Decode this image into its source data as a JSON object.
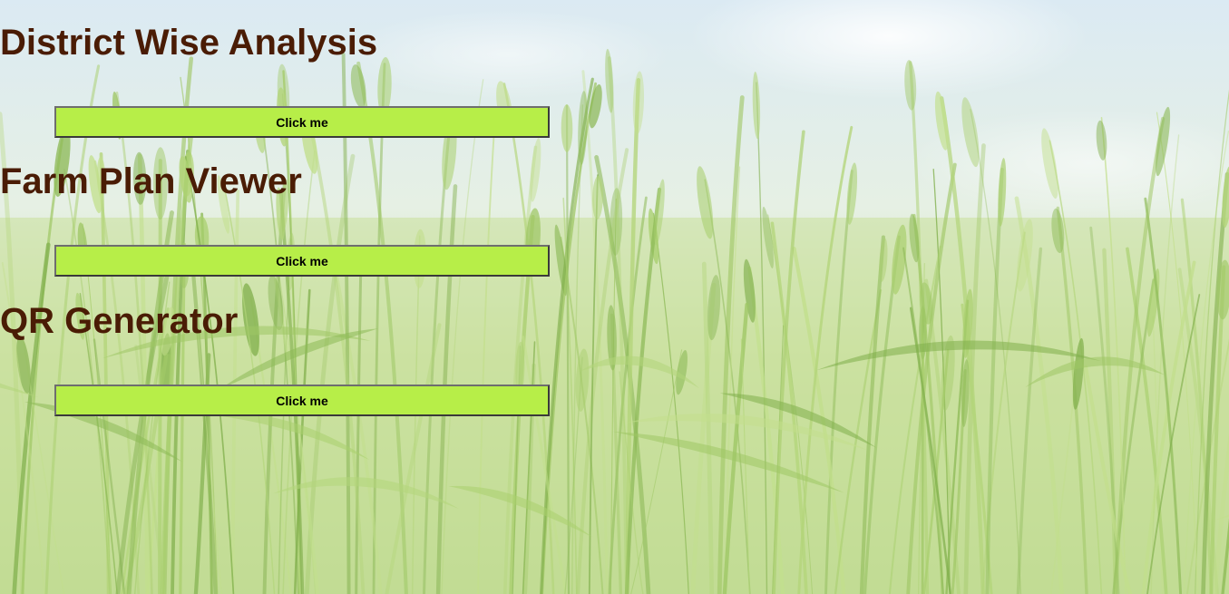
{
  "theme": {
    "heading_color": "#4a1c05",
    "button_color": "#b7ee48",
    "sky_color": "#e4eff6",
    "field_color": "#c6df98"
  },
  "background": {
    "icon": "wheat-field-photo"
  },
  "sections": [
    {
      "title": "District Wise Analysis",
      "button_label": "Click me"
    },
    {
      "title": "Farm Plan Viewer",
      "button_label": "Click me"
    },
    {
      "title": "QR Generator",
      "button_label": "Click me"
    }
  ]
}
